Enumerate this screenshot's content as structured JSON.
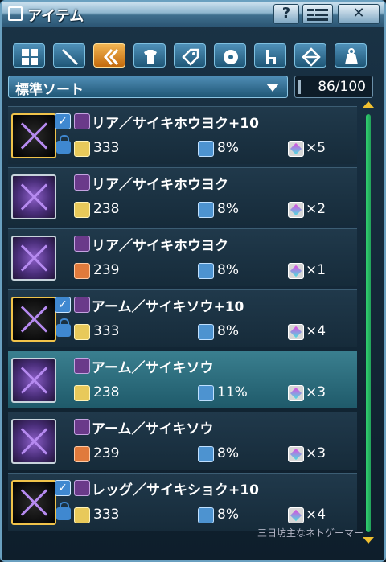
{
  "window": {
    "title": "アイテム",
    "help_label": "?",
    "close_label": "✕"
  },
  "tabs": [
    {
      "icon": "grid-icon"
    },
    {
      "icon": "sword-icon"
    },
    {
      "icon": "unit-icon",
      "active": true
    },
    {
      "icon": "shirt-icon"
    },
    {
      "icon": "tag-icon"
    },
    {
      "icon": "disc-icon"
    },
    {
      "icon": "chair-icon"
    },
    {
      "icon": "diamond-arrow-icon"
    },
    {
      "icon": "bag-icon"
    }
  ],
  "sort": {
    "label": "標準ソート",
    "count": "86/100"
  },
  "items": [
    {
      "name": "リア／サイキホウヨク+10",
      "atk": "333",
      "stat": "8%",
      "slots": "×5",
      "plus": true,
      "atk_red": false,
      "selected": false
    },
    {
      "name": "リア／サイキホウヨク",
      "atk": "238",
      "stat": "8%",
      "slots": "×2",
      "plus": false,
      "atk_red": false,
      "selected": false
    },
    {
      "name": "リア／サイキホウヨク",
      "atk": "239",
      "stat": "8%",
      "slots": "×1",
      "plus": false,
      "atk_red": true,
      "selected": false
    },
    {
      "name": "アーム／サイキソウ+10",
      "atk": "333",
      "stat": "8%",
      "slots": "×4",
      "plus": true,
      "atk_red": false,
      "selected": false
    },
    {
      "name": "アーム／サイキソウ",
      "atk": "238",
      "stat": "11%",
      "slots": "×3",
      "plus": false,
      "atk_red": false,
      "selected": true
    },
    {
      "name": "アーム／サイキソウ",
      "atk": "239",
      "stat": "8%",
      "slots": "×3",
      "plus": false,
      "atk_red": true,
      "selected": false
    },
    {
      "name": "レッグ／サイキショク+10",
      "atk": "333",
      "stat": "8%",
      "slots": "×4",
      "plus": true,
      "atk_red": false,
      "selected": false
    }
  ],
  "watermark": "三日坊主なネトゲーマー",
  "colors": {
    "accent_tab": "#f2b552",
    "selected_row": "#3a7f8f",
    "scrollbar": "#2fcf6e"
  }
}
